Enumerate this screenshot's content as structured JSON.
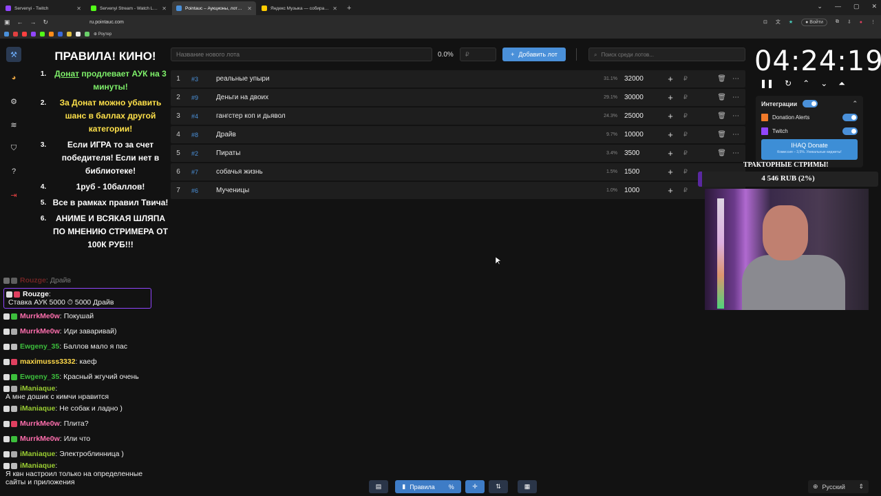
{
  "browser": {
    "tabs": [
      {
        "label": "Servenyi - Twitch",
        "color": "#9146ff",
        "active": false
      },
      {
        "label": "Servenyi Stream - Watch Live ...",
        "color": "#53fc18",
        "active": false
      },
      {
        "label": "Pointauc – Аукционы, лотерея ...",
        "color": "#4a90d9",
        "active": true
      },
      {
        "label": "Яндекс Музыка — собирае...",
        "color": "#ffcc00",
        "active": false
      }
    ],
    "url": "ru.pointauc.com",
    "bookmark_label": "Роутер",
    "signin_label": "Войти"
  },
  "rules": {
    "title": "ПРАВИЛА! КИНО!",
    "items": [
      {
        "n": "1.",
        "a": "Донат",
        "b": " продлевает АУК на 3 минуты!"
      },
      {
        "n": "2.",
        "a": "За Донат",
        "b": " можно убавить шанс в баллах другой категории!"
      },
      {
        "n": "3.",
        "text": "Если ИГРА то за счет победителя! Если нет в библиотеке!"
      },
      {
        "n": "4.",
        "text": "1руб - 10баллов!"
      },
      {
        "n": "5.",
        "text": "Все в рамках правил Твича!"
      },
      {
        "n": "6.",
        "text": "АНИМЕ И ВСЯКАЯ ШЛЯПА ПО МНЕНИЮ СТРИМЕРА ОТ 100К РУБ!!!"
      }
    ]
  },
  "controls": {
    "lot_placeholder": "Название нового лота",
    "percent": "0.0%",
    "rub_placeholder": "₽",
    "add_label": "Добавить лот",
    "search_placeholder": "Поиск среди лотов..."
  },
  "lots": [
    {
      "idx": "1",
      "id": "#3",
      "name": "реальные упыри",
      "pct": "31.1%",
      "amount": "32000"
    },
    {
      "idx": "2",
      "id": "#9",
      "name": "Деньги на двоих",
      "pct": "29.1%",
      "amount": "30000"
    },
    {
      "idx": "3",
      "id": "#4",
      "name": "гангстер коп и дьявол",
      "pct": "24.3%",
      "amount": "25000"
    },
    {
      "idx": "4",
      "id": "#8",
      "name": "Драйв",
      "pct": "9.7%",
      "amount": "10000"
    },
    {
      "idx": "5",
      "id": "#2",
      "name": "Пираты",
      "pct": "3.4%",
      "amount": "3500"
    },
    {
      "idx": "6",
      "id": "#7",
      "name": "собачья жизнь",
      "pct": "1.5%",
      "amount": "1500"
    },
    {
      "idx": "7",
      "id": "#6",
      "name": "Мученицы",
      "pct": "1.0%",
      "amount": "1000"
    }
  ],
  "timer": {
    "value": "04:24:19"
  },
  "integrations": {
    "title": "Интеграции",
    "items": [
      "Donation Alerts",
      "Twitch"
    ],
    "donate_label": "IHAQ Donate",
    "donate_sub": "Комиссия – 3,5%. Уникальные виджеты!"
  },
  "donation_goal": {
    "title": "ТРАКТОРНЫЕ СТРИМЫ!",
    "amount": "4 546 RUB (2%)",
    "progress_fraction": 0.02
  },
  "chat": [
    {
      "user": "Rouzge",
      "color": "#e03a3a",
      "msg": "Драйв",
      "fade": true
    },
    {
      "user": "Rouzge",
      "color": "#ffffff",
      "msg": "Ставка АУК 5000  ⏱ 5000 Драйв",
      "highlight": true
    },
    {
      "user": "MurrkMe0w",
      "color": "#ff6fae",
      "msg": "Покушай"
    },
    {
      "user": "MurrkMe0w",
      "color": "#ff6fae",
      "msg": "Иди заваривай)"
    },
    {
      "user": "Ewgeny_35",
      "color": "#3cbf3c",
      "msg": "Баллов мало я пас"
    },
    {
      "user": "maximusss3332",
      "color": "#ffd94a",
      "msg": "каеф"
    },
    {
      "user": "Ewgeny_35",
      "color": "#3cbf3c",
      "msg": "Красный жгучий очень"
    },
    {
      "user": "iManiaque",
      "color": "#9acd32",
      "msg": "А мне дошик с кимчи нравится"
    },
    {
      "user": "iManiaque",
      "color": "#9acd32",
      "msg": "Не собак и ладно )"
    },
    {
      "user": "MurrkMe0w",
      "color": "#ff6fae",
      "msg": "Плита?"
    },
    {
      "user": "MurrkMe0w",
      "color": "#ff6fae",
      "msg": "Или что"
    },
    {
      "user": "iManiaque",
      "color": "#9acd32",
      "msg": "Электроблинница )"
    },
    {
      "user": "iManiaque",
      "color": "#9acd32",
      "msg": "Я квн настроил только на определенные сайты и приложения"
    }
  ],
  "bottom": {
    "rules_label": "Правила",
    "language": "Русский"
  },
  "colors": {
    "accent": "#4a90d9",
    "twitch": "#9146ff",
    "background": "#121212"
  }
}
